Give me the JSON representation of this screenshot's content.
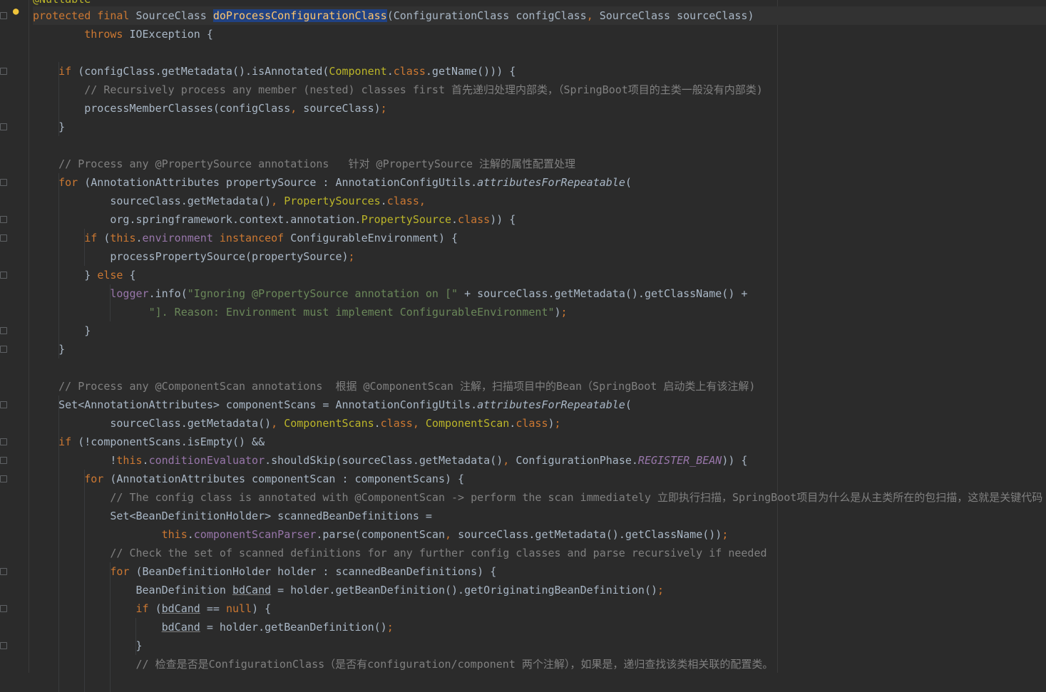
{
  "editor": {
    "fragment_top": "@Nullable",
    "lines": [
      [
        {
          "t": "protected final ",
          "c": "kw"
        },
        {
          "t": "SourceClass ",
          "c": ""
        },
        {
          "t": "doProcessConfigurationClass",
          "c": "fn-sel"
        },
        {
          "t": "(ConfigurationClass configClass",
          "c": ""
        },
        {
          "t": ", ",
          "c": "kw"
        },
        {
          "t": "SourceClass sourceClass)",
          "c": ""
        }
      ],
      [
        {
          "t": "        ",
          "c": ""
        },
        {
          "t": "throws ",
          "c": "kw"
        },
        {
          "t": "IOException {",
          "c": ""
        }
      ],
      [],
      [
        {
          "t": "    ",
          "c": ""
        },
        {
          "t": "if ",
          "c": "kw"
        },
        {
          "t": "(configClass.getMetadata().isAnnotated(",
          "c": ""
        },
        {
          "t": "Component",
          "c": "cls"
        },
        {
          "t": ".",
          "c": ""
        },
        {
          "t": "class",
          "c": "kw"
        },
        {
          "t": ".getName())) {",
          "c": ""
        }
      ],
      [
        {
          "t": "        // Recursively process any member (nested) classes first 首先递归处理内部类，（SpringBoot项目的主类一般没有内部类)",
          "c": "cmt"
        }
      ],
      [
        {
          "t": "        processMemberClasses(configClass",
          "c": ""
        },
        {
          "t": ", ",
          "c": "kw"
        },
        {
          "t": "sourceClass)",
          "c": ""
        },
        {
          "t": ";",
          "c": "kw"
        }
      ],
      [
        {
          "t": "    }",
          "c": ""
        }
      ],
      [],
      [
        {
          "t": "    // Process any @PropertySource annotations   针对 @PropertySource 注解的属性配置处理",
          "c": "cmt"
        }
      ],
      [
        {
          "t": "    ",
          "c": ""
        },
        {
          "t": "for ",
          "c": "kw"
        },
        {
          "t": "(AnnotationAttributes propertySource : AnnotationConfigUtils.",
          "c": ""
        },
        {
          "t": "attributesForRepeatable",
          "c": "ital"
        },
        {
          "t": "(",
          "c": ""
        }
      ],
      [
        {
          "t": "            sourceClass.getMetadata()",
          "c": ""
        },
        {
          "t": ", ",
          "c": "kw"
        },
        {
          "t": "PropertySources",
          "c": "cls"
        },
        {
          "t": ".",
          "c": ""
        },
        {
          "t": "class",
          "c": "kw"
        },
        {
          "t": ",",
          "c": "kw"
        }
      ],
      [
        {
          "t": "            org.springframework.context.annotation.",
          "c": ""
        },
        {
          "t": "PropertySource",
          "c": "cls"
        },
        {
          "t": ".",
          "c": ""
        },
        {
          "t": "class",
          "c": "kw"
        },
        {
          "t": ")) {",
          "c": ""
        }
      ],
      [
        {
          "t": "        ",
          "c": ""
        },
        {
          "t": "if ",
          "c": "kw"
        },
        {
          "t": "(",
          "c": ""
        },
        {
          "t": "this",
          "c": "kw"
        },
        {
          "t": ".",
          "c": ""
        },
        {
          "t": "environment ",
          "c": "fld"
        },
        {
          "t": "instanceof ",
          "c": "kw"
        },
        {
          "t": "ConfigurableEnvironment) {",
          "c": ""
        }
      ],
      [
        {
          "t": "            processPropertySource(propertySource)",
          "c": ""
        },
        {
          "t": ";",
          "c": "kw"
        }
      ],
      [
        {
          "t": "        } ",
          "c": ""
        },
        {
          "t": "else ",
          "c": "kw"
        },
        {
          "t": "{",
          "c": ""
        }
      ],
      [
        {
          "t": "            ",
          "c": ""
        },
        {
          "t": "logger",
          "c": "fld"
        },
        {
          "t": ".info(",
          "c": ""
        },
        {
          "t": "\"Ignoring @PropertySource annotation on [\" ",
          "c": "str"
        },
        {
          "t": "+ sourceClass.getMetadata().getClassName() +",
          "c": ""
        }
      ],
      [
        {
          "t": "                  ",
          "c": ""
        },
        {
          "t": "\"]. Reason: Environment must implement ConfigurableEnvironment\"",
          "c": "str"
        },
        {
          "t": ")",
          "c": ""
        },
        {
          "t": ";",
          "c": "kw"
        }
      ],
      [
        {
          "t": "        }",
          "c": ""
        }
      ],
      [
        {
          "t": "    }",
          "c": ""
        }
      ],
      [],
      [
        {
          "t": "    // Process any @ComponentScan annotations  根据 @ComponentScan 注解，扫描项目中的Bean（SpringBoot 启动类上有该注解)",
          "c": "cmt"
        }
      ],
      [
        {
          "t": "    Set<AnnotationAttributes> componentScans = AnnotationConfigUtils.",
          "c": ""
        },
        {
          "t": "attributesForRepeatable",
          "c": "ital"
        },
        {
          "t": "(",
          "c": ""
        }
      ],
      [
        {
          "t": "            sourceClass.getMetadata()",
          "c": ""
        },
        {
          "t": ", ",
          "c": "kw"
        },
        {
          "t": "ComponentScans",
          "c": "cls"
        },
        {
          "t": ".",
          "c": ""
        },
        {
          "t": "class",
          "c": "kw"
        },
        {
          "t": ", ",
          "c": "kw"
        },
        {
          "t": "ComponentScan",
          "c": "cls"
        },
        {
          "t": ".",
          "c": ""
        },
        {
          "t": "class",
          "c": "kw"
        },
        {
          "t": ")",
          "c": ""
        },
        {
          "t": ";",
          "c": "kw"
        }
      ],
      [
        {
          "t": "    ",
          "c": ""
        },
        {
          "t": "if ",
          "c": "kw"
        },
        {
          "t": "(!componentScans.isEmpty() &&",
          "c": ""
        }
      ],
      [
        {
          "t": "            !",
          "c": ""
        },
        {
          "t": "this",
          "c": "kw"
        },
        {
          "t": ".",
          "c": ""
        },
        {
          "t": "conditionEvaluator",
          "c": "fld"
        },
        {
          "t": ".shouldSkip(sourceClass.getMetadata()",
          "c": ""
        },
        {
          "t": ", ",
          "c": "kw"
        },
        {
          "t": "ConfigurationPhase.",
          "c": ""
        },
        {
          "t": "REGISTER_BEAN",
          "c": "fld ital"
        },
        {
          "t": ")) {",
          "c": ""
        }
      ],
      [
        {
          "t": "        ",
          "c": ""
        },
        {
          "t": "for ",
          "c": "kw"
        },
        {
          "t": "(AnnotationAttributes componentScan : componentScans) {",
          "c": ""
        }
      ],
      [
        {
          "t": "            // The config class is annotated with @ComponentScan -> perform the scan immediately 立即执行扫描，SpringBoot项目为什么是从主类所在的包扫描，这就是关键代码",
          "c": "cmt"
        }
      ],
      [
        {
          "t": "            Set<BeanDefinitionHolder> scannedBeanDefinitions =",
          "c": ""
        }
      ],
      [
        {
          "t": "                    ",
          "c": ""
        },
        {
          "t": "this",
          "c": "kw"
        },
        {
          "t": ".",
          "c": ""
        },
        {
          "t": "componentScanParser",
          "c": "fld"
        },
        {
          "t": ".parse(componentScan",
          "c": ""
        },
        {
          "t": ", ",
          "c": "kw"
        },
        {
          "t": "sourceClass.getMetadata().getClassName())",
          "c": ""
        },
        {
          "t": ";",
          "c": "kw"
        }
      ],
      [
        {
          "t": "            // Check the set of scanned definitions for any further config classes and parse recursively if needed",
          "c": "cmt"
        }
      ],
      [
        {
          "t": "            ",
          "c": ""
        },
        {
          "t": "for ",
          "c": "kw"
        },
        {
          "t": "(BeanDefinitionHolder holder : scannedBeanDefinitions) {",
          "c": ""
        }
      ],
      [
        {
          "t": "                BeanDefinition ",
          "c": ""
        },
        {
          "t": "bdCand",
          "c": "ul"
        },
        {
          "t": " = holder.getBeanDefinition().getOriginatingBeanDefinition()",
          "c": ""
        },
        {
          "t": ";",
          "c": "kw"
        }
      ],
      [
        {
          "t": "                ",
          "c": ""
        },
        {
          "t": "if ",
          "c": "kw"
        },
        {
          "t": "(",
          "c": ""
        },
        {
          "t": "bdCand",
          "c": "ul"
        },
        {
          "t": " == ",
          "c": ""
        },
        {
          "t": "null",
          "c": "kw"
        },
        {
          "t": ") {",
          "c": ""
        }
      ],
      [
        {
          "t": "                    ",
          "c": ""
        },
        {
          "t": "bdCand",
          "c": "ul"
        },
        {
          "t": " = holder.getBeanDefinition()",
          "c": ""
        },
        {
          "t": ";",
          "c": "kw"
        }
      ],
      [
        {
          "t": "                }",
          "c": ""
        }
      ],
      [
        {
          "t": "                // 检查是否是ConfigurationClass（是否有configuration/component 两个注解），如果是，递归查找该类相关联的配置类。",
          "c": "cmt"
        }
      ]
    ]
  }
}
